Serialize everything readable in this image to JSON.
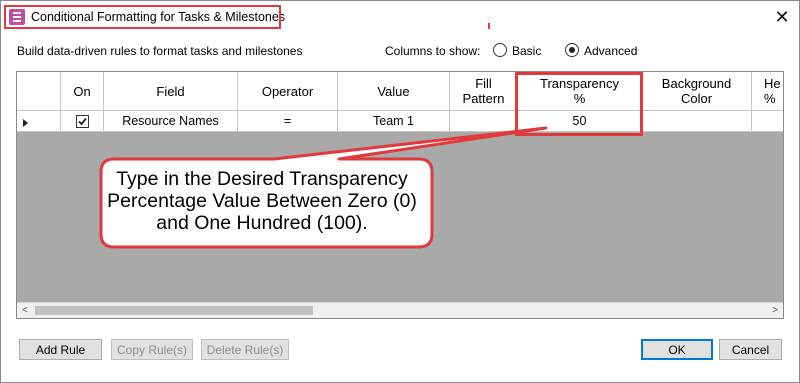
{
  "window": {
    "title": "Conditional Formatting for Tasks & Milestones",
    "close_glyph": "✕",
    "app_icon": "conditional-formatting-icon"
  },
  "subheader": {
    "description": "Build data-driven rules to format tasks and milestones",
    "columns_label": "Columns to show:",
    "options": [
      {
        "label": "Basic",
        "selected": false
      },
      {
        "label": "Advanced",
        "selected": true
      }
    ]
  },
  "grid": {
    "headers": {
      "on": "On",
      "field": "Field",
      "operator": "Operator",
      "value": "Value",
      "fill_pattern_1": "Fill",
      "fill_pattern_2": "Pattern",
      "transparency_1": "Transparency",
      "transparency_2": "%",
      "background_1": "Background",
      "background_2": "Color",
      "he_1": "He",
      "he_2": "%"
    },
    "rows": [
      {
        "on": true,
        "field": "Resource Names",
        "operator": "=",
        "value": "Team 1",
        "fill_pattern": "",
        "transparency": "50",
        "background_color": "",
        "he": ""
      }
    ],
    "scroll_left": "<",
    "scroll_right": ">"
  },
  "callout": {
    "line1": "Type in the Desired Transparency",
    "line2": "Percentage Value Between Zero (0)",
    "line3": "and One Hundred (100).",
    "color": "#e03a3e"
  },
  "buttons": {
    "add_rule": "Add Rule",
    "copy_rules": "Copy Rule(s)",
    "delete_rules": "Delete Rule(s)",
    "ok": "OK",
    "cancel": "Cancel"
  }
}
